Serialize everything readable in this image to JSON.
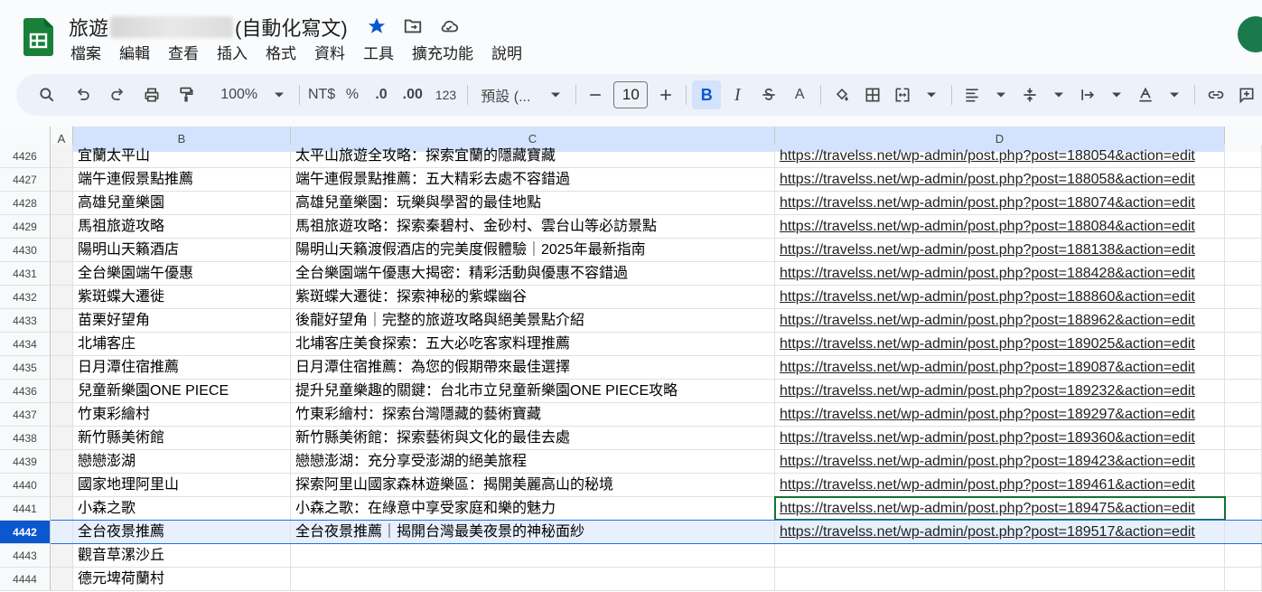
{
  "doc": {
    "title_prefix": "旅遊",
    "title_suffix": "(自動化寫文)"
  },
  "menu": [
    "檔案",
    "編輯",
    "查看",
    "插入",
    "格式",
    "資料",
    "工具",
    "擴充功能",
    "說明"
  ],
  "toolbar": {
    "zoom": "100%",
    "currency": "NT$",
    "percent": "%",
    "dec_decrease": ".0",
    "dec_increase": ".00",
    "number_format": "123",
    "font": "預設 (...",
    "font_size": "10",
    "bold": "B",
    "italic": "I",
    "text_color": "A"
  },
  "columns": [
    "A",
    "B",
    "C",
    "D"
  ],
  "rows": [
    {
      "num": "4426",
      "b": "宜蘭太平山",
      "c": "太平山旅遊全攻略：探索宜蘭的隱藏寶藏",
      "d": "https://travelss.net/wp-admin/post.php?post=188054&action=edit"
    },
    {
      "num": "4427",
      "b": "端午連假景點推薦",
      "c": "端午連假景點推薦：五大精彩去處不容錯過",
      "d": "https://travelss.net/wp-admin/post.php?post=188058&action=edit"
    },
    {
      "num": "4428",
      "b": "高雄兒童樂園",
      "c": "高雄兒童樂園：玩樂與學習的最佳地點",
      "d": "https://travelss.net/wp-admin/post.php?post=188074&action=edit"
    },
    {
      "num": "4429",
      "b": "馬祖旅遊攻略",
      "c": "馬祖旅遊攻略：探索秦碧村、金砂村、雲台山等必訪景點",
      "d": "https://travelss.net/wp-admin/post.php?post=188084&action=edit"
    },
    {
      "num": "4430",
      "b": "陽明山天籟酒店",
      "c": "陽明山天籟渡假酒店的完美度假體驗｜2025年最新指南",
      "d": "https://travelss.net/wp-admin/post.php?post=188138&action=edit"
    },
    {
      "num": "4431",
      "b": "全台樂園端午優惠",
      "c": "全台樂園端午優惠大揭密：精彩活動與優惠不容錯過",
      "d": "https://travelss.net/wp-admin/post.php?post=188428&action=edit"
    },
    {
      "num": "4432",
      "b": "紫斑蝶大遷徙",
      "c": "紫斑蝶大遷徙：探索神秘的紫蝶幽谷",
      "d": "https://travelss.net/wp-admin/post.php?post=188860&action=edit"
    },
    {
      "num": "4433",
      "b": "苗栗好望角",
      "c": "後龍好望角｜完整的旅遊攻略與絕美景點介紹",
      "d": "https://travelss.net/wp-admin/post.php?post=188962&action=edit"
    },
    {
      "num": "4434",
      "b": "北埔客庄",
      "c": "北埔客庄美食探索：五大必吃客家料理推薦",
      "d": "https://travelss.net/wp-admin/post.php?post=189025&action=edit"
    },
    {
      "num": "4435",
      "b": "日月潭住宿推薦",
      "c": "日月潭住宿推薦：為您的假期帶來最佳選擇",
      "d": "https://travelss.net/wp-admin/post.php?post=189087&action=edit"
    },
    {
      "num": "4436",
      "b": "兒童新樂園ONE PIECE",
      "c": "提升兒童樂趣的關鍵：台北市立兒童新樂園ONE PIECE攻略",
      "d": "https://travelss.net/wp-admin/post.php?post=189232&action=edit"
    },
    {
      "num": "4437",
      "b": "竹東彩繪村",
      "c": "竹東彩繪村：探索台灣隱藏的藝術寶藏",
      "d": "https://travelss.net/wp-admin/post.php?post=189297&action=edit"
    },
    {
      "num": "4438",
      "b": "新竹縣美術館",
      "c": "新竹縣美術館：探索藝術與文化的最佳去處",
      "d": "https://travelss.net/wp-admin/post.php?post=189360&action=edit"
    },
    {
      "num": "4439",
      "b": "戀戀澎湖",
      "c": "戀戀澎湖：充分享受澎湖的絕美旅程",
      "d": "https://travelss.net/wp-admin/post.php?post=189423&action=edit"
    },
    {
      "num": "4440",
      "b": "國家地理阿里山",
      "c": "探索阿里山國家森林遊樂區：揭開美麗高山的秘境",
      "d": "https://travelss.net/wp-admin/post.php?post=189461&action=edit"
    },
    {
      "num": "4441",
      "b": "小森之歌",
      "c": "小森之歌：在綠意中享受家庭和樂的魅力",
      "d": "https://travelss.net/wp-admin/post.php?post=189475&action=edit"
    },
    {
      "num": "4442",
      "b": "全台夜景推薦",
      "c": "全台夜景推薦｜揭開台灣最美夜景的神秘面紗",
      "d": "https://travelss.net/wp-admin/post.php?post=189517&action=edit"
    },
    {
      "num": "4443",
      "b": "觀音草漯沙丘",
      "c": "",
      "d": ""
    },
    {
      "num": "4444",
      "b": "德元埤荷蘭村",
      "c": "",
      "d": ""
    }
  ],
  "selected_row": "4442",
  "active_cell_row": "4441",
  "colors": {
    "sheets_green": "#188038",
    "accent_blue": "#0b57d0",
    "star": "#0b57d0"
  }
}
